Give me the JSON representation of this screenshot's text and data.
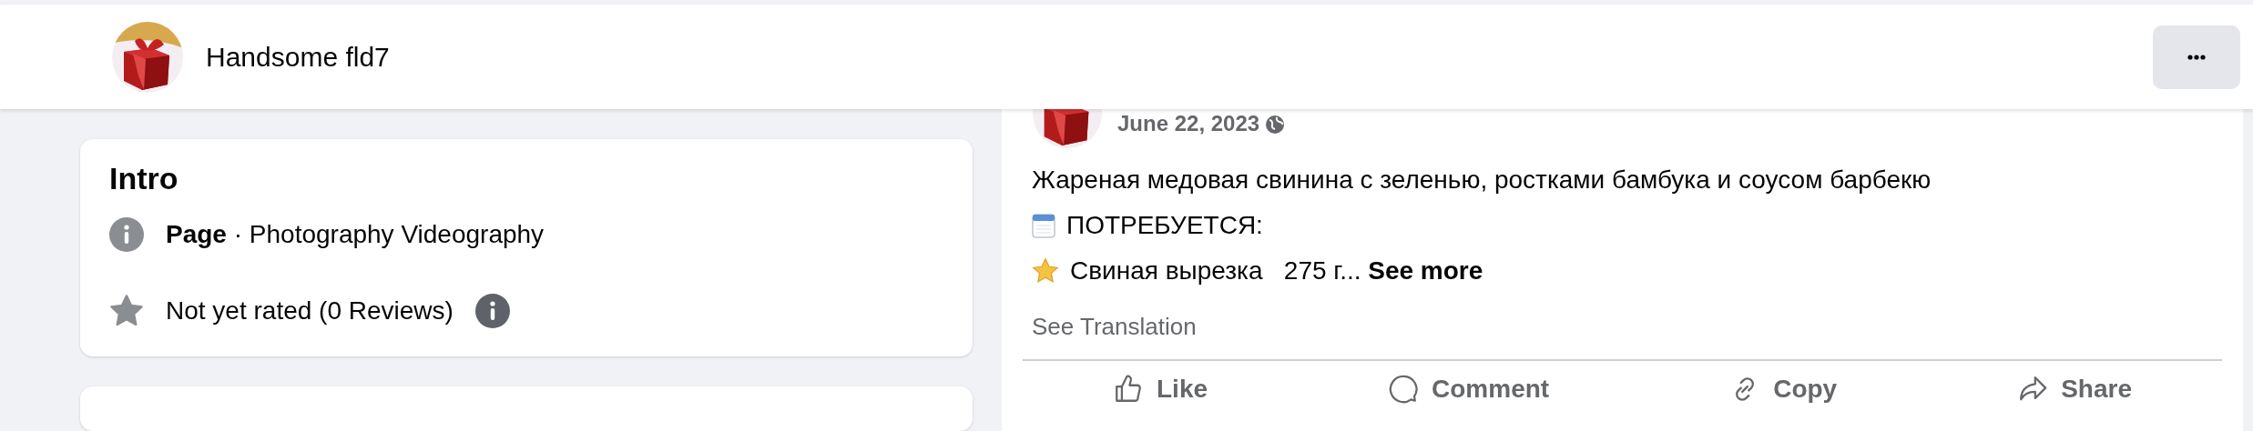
{
  "header": {
    "name": "Handsome fld7"
  },
  "intro": {
    "title": "Intro",
    "rows": [
      {
        "kind": "category",
        "text": "**Page** · Photography Videography"
      },
      {
        "kind": "rating",
        "text": "Not yet rated (0 Reviews)"
      }
    ]
  },
  "post": {
    "date": "June 22, 2023",
    "lines": [
      {
        "kind": "plain",
        "text": "Жареная медовая свинина с зеленью, ростками бамбука и соусом барбекю"
      },
      {
        "kind": "calendar",
        "text": "ПОТРЕБУЕТСЯ:"
      },
      {
        "kind": "star",
        "text": "Свиная вырезка   275 г...",
        "more": "See more"
      }
    ],
    "translation": "See Translation",
    "actions": [
      {
        "kind": "like",
        "label": "Like"
      },
      {
        "kind": "comment",
        "label": "Comment"
      },
      {
        "kind": "copy",
        "label": "Copy"
      },
      {
        "kind": "share",
        "label": "Share"
      }
    ]
  }
}
